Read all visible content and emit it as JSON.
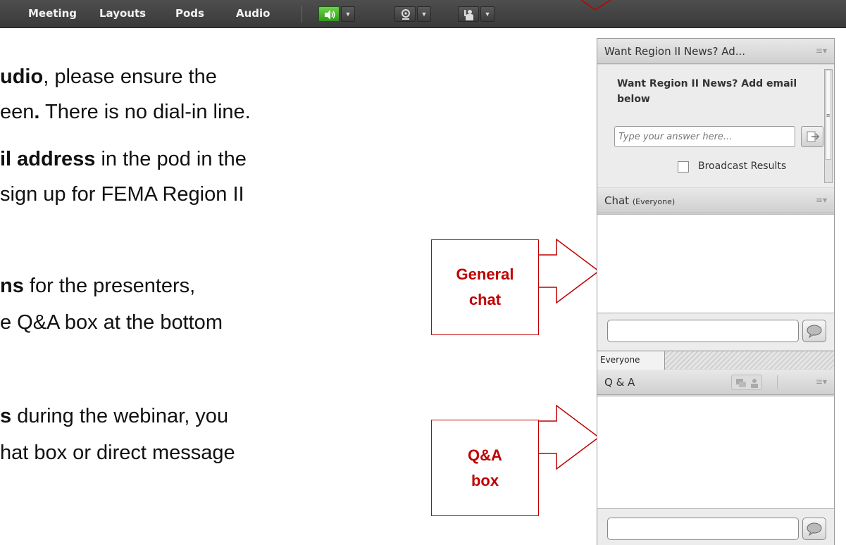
{
  "menubar": {
    "items": [
      "Meeting",
      "Layouts",
      "Pods",
      "Audio"
    ]
  },
  "slide": {
    "lines": [
      {
        "pre": "",
        "bold": "udio",
        "post": ", please ensure the"
      },
      {
        "pre": "een",
        "bold": ".",
        "post": " There is no dial-in line."
      },
      {
        "pre": "",
        "bold": "il address",
        "post": " in the pod in the"
      },
      {
        "pre": "sign up for FEMA Region II",
        "bold": "",
        "post": ""
      },
      {
        "pre": "",
        "bold": "ns",
        "post": " for the presenters,"
      },
      {
        "pre": "e Q&A box at the bottom",
        "bold": "",
        "post": ""
      },
      {
        "pre": "",
        "bold": "s",
        "post": " during the webinar, you"
      },
      {
        "pre": "hat box or direct message",
        "bold": "",
        "post": ""
      }
    ]
  },
  "callouts": {
    "general_chat": "General chat",
    "qa_box": "Q&A box"
  },
  "poll_pod": {
    "title": "Want Region II News? Ad...",
    "question": "Want Region II News? Add email below",
    "placeholder": "Type your answer here...",
    "broadcast_label": "Broadcast Results"
  },
  "chat_pod": {
    "title": "Chat",
    "scope": "(Everyone)",
    "tab_label": "Everyone"
  },
  "qa_pod": {
    "title": "Q & A"
  },
  "colors": {
    "callout_red": "#c00000",
    "audio_green": "#3aa820"
  }
}
